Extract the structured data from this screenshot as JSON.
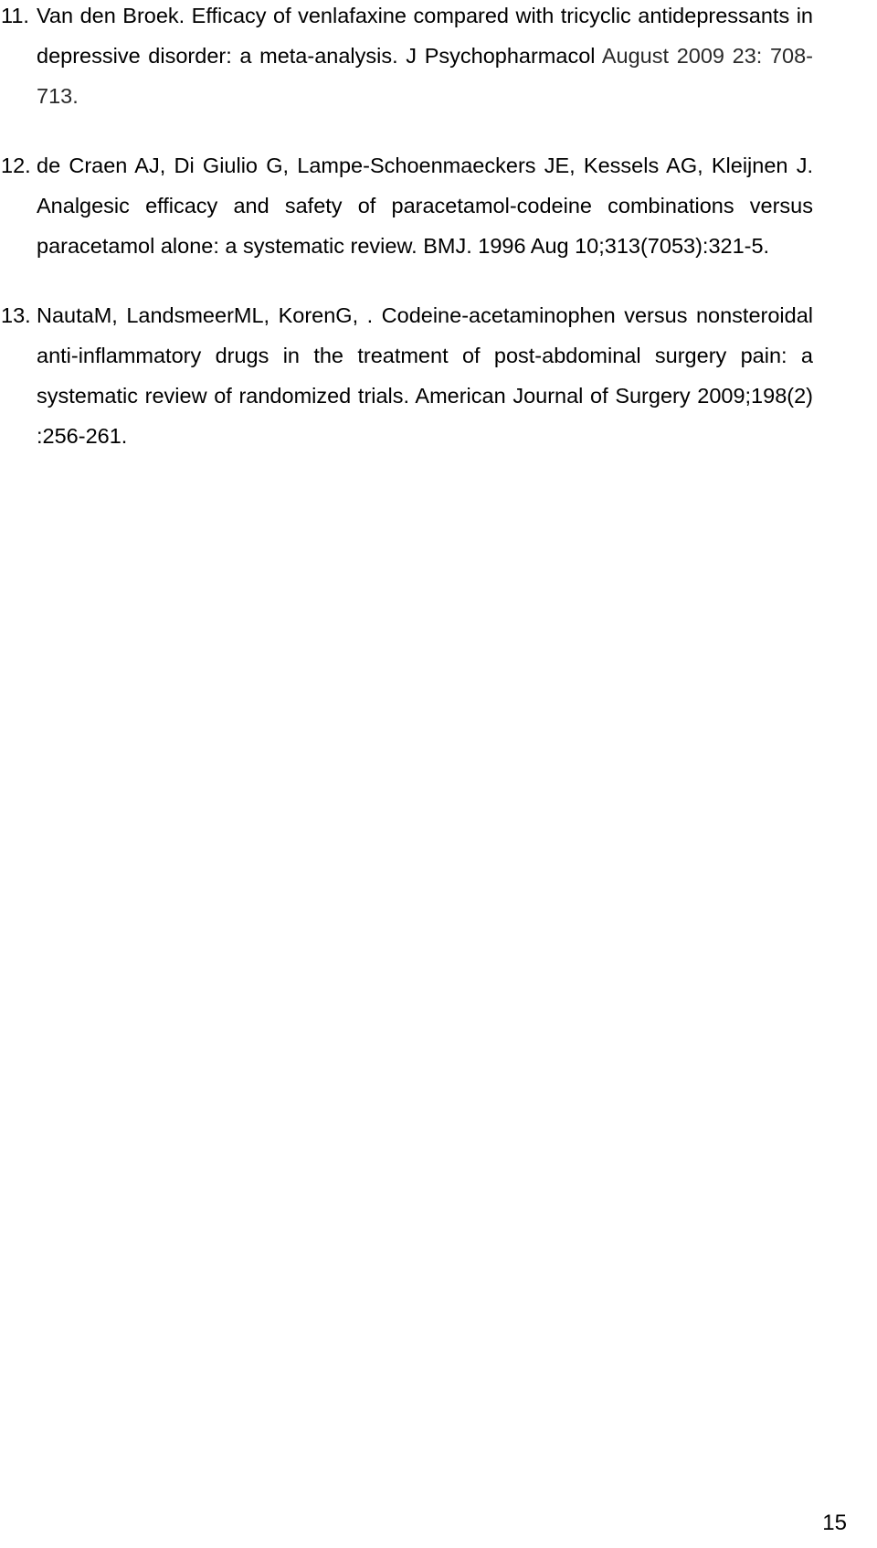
{
  "references": [
    {
      "number": "11.",
      "text": "Van den Broek. Efficacy of venlafaxine compared with tricyclic antidepressants in depressive disorder: a meta-analysis. J Psychopharmacol",
      "text_tail": " August 2009 23: 708-713."
    },
    {
      "number": "12.",
      "text": "de Craen AJ, Di Giulio G, Lampe-Schoenmaeckers JE, Kessels AG, Kleijnen J. Analgesic efficacy and safety of paracetamol-codeine combinations versus paracetamol alone: a systematic review. BMJ. 1996 Aug 10;313(7053):321-5.",
      "text_tail": ""
    },
    {
      "number": "13.",
      "text": "NautaM, LandsmeerML, KorenG, . Codeine-acetaminophen versus nonsteroidal anti-inflammatory drugs in the treatment of post-abdominal surgery pain: a systematic review of randomized trials. American Journal of Surgery 2009;198(2) :256-261.",
      "text_tail": ""
    }
  ],
  "page_number": "15"
}
